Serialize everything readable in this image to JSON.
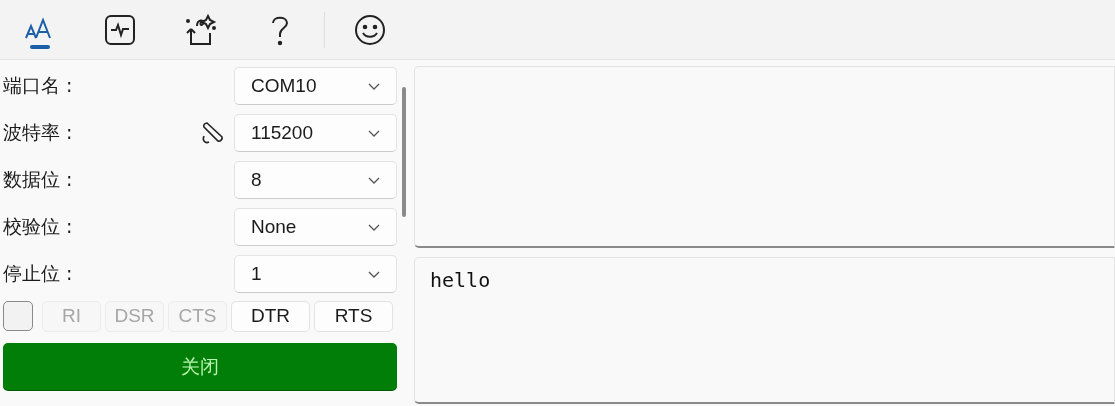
{
  "toolbar": [
    {
      "kind": "font",
      "selected": true
    },
    {
      "kind": "pulse",
      "selected": false
    },
    {
      "kind": "magic",
      "selected": false
    },
    {
      "kind": "help",
      "selected": false
    },
    {
      "kind": "divider"
    },
    {
      "kind": "smiley",
      "selected": false
    }
  ],
  "settings": [
    {
      "label": "端口名 :",
      "value": "COM10",
      "has_icon": false
    },
    {
      "label": "波特率 :",
      "value": "115200",
      "has_icon": true
    },
    {
      "label": "数据位 :",
      "value": "8",
      "has_icon": false
    },
    {
      "label": "校验位 :",
      "value": "None",
      "has_icon": false
    },
    {
      "label": "停止位 :",
      "value": "1",
      "has_icon": false
    }
  ],
  "signals": {
    "checked": false,
    "lines": [
      {
        "label": "RI",
        "disabled": true
      },
      {
        "label": "DSR",
        "disabled": true
      },
      {
        "label": "CTS",
        "disabled": true
      },
      {
        "label": "DTR",
        "disabled": false
      },
      {
        "label": "RTS",
        "disabled": false
      }
    ]
  },
  "close_button": {
    "label": "关闭"
  },
  "send": {
    "value": "hello"
  }
}
